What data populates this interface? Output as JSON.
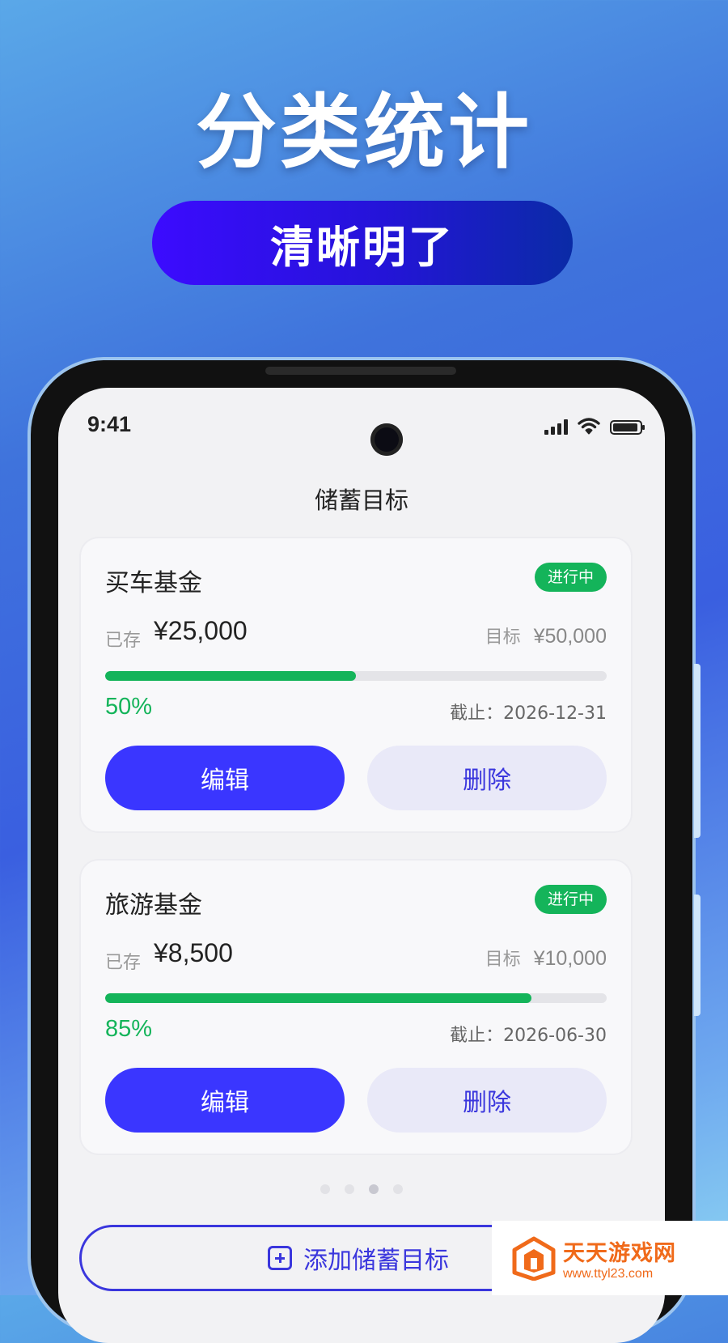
{
  "promo": {
    "headline": "分类统计",
    "subheadline": "清晰明了"
  },
  "status_bar": {
    "time": "9:41",
    "icons": [
      "signal-icon",
      "wifi-icon",
      "battery-icon"
    ]
  },
  "page": {
    "title": "储蓄目标"
  },
  "goals": [
    {
      "name": "买车基金",
      "status": "进行中",
      "saved_label": "已存",
      "saved_amount": "¥25,000",
      "target_label": "目标",
      "target_amount": "¥50,000",
      "progress": 0.5,
      "percent_text": "50%",
      "deadline": "截止：2026-12-31",
      "edit_label": "编辑",
      "delete_label": "删除"
    },
    {
      "name": "旅游基金",
      "status": "进行中",
      "saved_label": "已存",
      "saved_amount": "¥8,500",
      "target_label": "目标",
      "target_amount": "¥10,000",
      "progress": 0.85,
      "percent_text": "85%",
      "deadline": "截止：2026-06-30",
      "edit_label": "编辑",
      "delete_label": "删除"
    }
  ],
  "pager": {
    "count": 4,
    "active": 2
  },
  "add_button": {
    "label": "添加储蓄目标",
    "icon": "plus-square-icon"
  },
  "watermark": {
    "name": "天天游戏网",
    "url": "www.ttyl23.com"
  },
  "colors": {
    "accent": "#3a36ff",
    "success": "#14b45a",
    "pill_start": "#3c0bff",
    "pill_end": "#0a2ba6"
  }
}
